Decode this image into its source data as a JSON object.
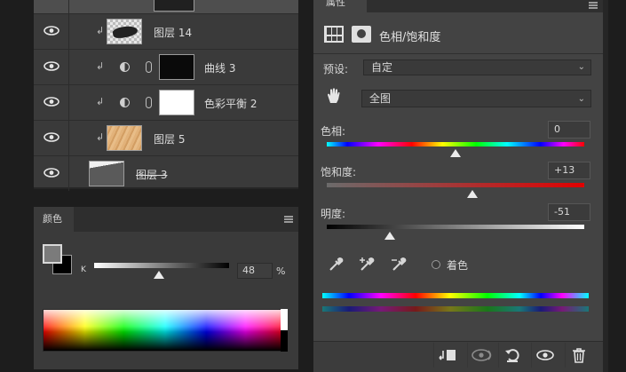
{
  "layers_panel": {
    "rows": [
      {
        "name": "图层 14"
      },
      {
        "name": "曲线 3"
      },
      {
        "name": "色彩平衡 2"
      },
      {
        "name": "图层 5"
      },
      {
        "name": "图层 3"
      }
    ]
  },
  "color_panel": {
    "tab_label": "颜色",
    "slider_label": "K",
    "value": "48",
    "unit": "%",
    "level": 0.48
  },
  "properties_panel": {
    "tab_label": "属性",
    "title": "色相/饱和度",
    "preset_label": "预设:",
    "preset_value": "自定",
    "channel_value": "全图",
    "hue": {
      "label": "色相:",
      "value": "0",
      "level": 0.5
    },
    "saturation": {
      "label": "饱和度:",
      "value": "+13",
      "level": 0.565
    },
    "lightness": {
      "label": "明度:",
      "value": "-51",
      "level": 0.245
    },
    "colorize_label": "着色",
    "icons": [
      "adjustment-layer-icon",
      "mask-icon",
      "target-adjust-hand-icon",
      "eyedropper-icon",
      "eyedropper-plus-icon",
      "eyedropper-minus-icon",
      "clip-to-layer-icon",
      "toggle-visibility-eye-icon",
      "reset-icon",
      "visibility-icon",
      "trash-icon"
    ]
  }
}
